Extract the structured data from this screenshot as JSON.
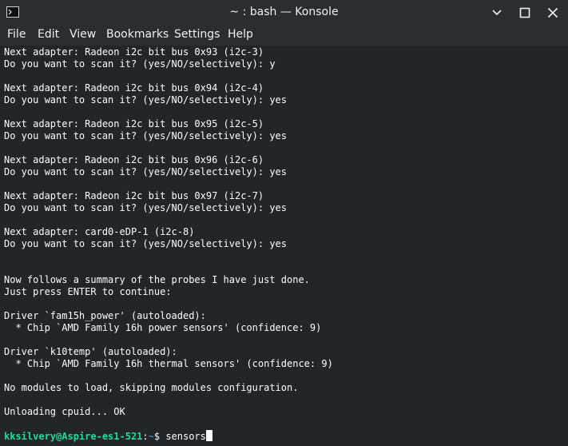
{
  "window": {
    "title": "~ : bash — Konsole",
    "icon": "terminal-app-icon",
    "controls": [
      "minimize-icon",
      "maximize-icon",
      "close-icon"
    ]
  },
  "menu": {
    "file": "File",
    "edit": "Edit",
    "view": "View",
    "bookmarks": "Bookmarks",
    "settings": "Settings",
    "help": "Help"
  },
  "terminal": {
    "output": "Next adapter: Radeon i2c bit bus 0x93 (i2c-3)\nDo you want to scan it? (yes/NO/selectively): y\n\nNext adapter: Radeon i2c bit bus 0x94 (i2c-4)\nDo you want to scan it? (yes/NO/selectively): yes\n\nNext adapter: Radeon i2c bit bus 0x95 (i2c-5)\nDo you want to scan it? (yes/NO/selectively): yes\n\nNext adapter: Radeon i2c bit bus 0x96 (i2c-6)\nDo you want to scan it? (yes/NO/selectively): yes\n\nNext adapter: Radeon i2c bit bus 0x97 (i2c-7)\nDo you want to scan it? (yes/NO/selectively): yes\n\nNext adapter: card0-eDP-1 (i2c-8)\nDo you want to scan it? (yes/NO/selectively): yes\n\n\nNow follows a summary of the probes I have just done.\nJust press ENTER to continue:\n\nDriver `fam15h_power' (autoloaded):\n  * Chip `AMD Family 16h power sensors' (confidence: 9)\n\nDriver `k10temp' (autoloaded):\n  * Chip `AMD Family 16h thermal sensors' (confidence: 9)\n\nNo modules to load, skipping modules configuration.\n\nUnloading cpuid... OK\n",
    "prompt_user": "kksilvery@Aspire-es1-521",
    "prompt_sep": ":",
    "prompt_path": "~",
    "prompt_symbol": "$ ",
    "command": "sensors"
  },
  "colors": {
    "background": "#232629",
    "titlebar": "#2a2e32",
    "text": "#fcfcfc",
    "prompt_user": "#1cdc9a",
    "prompt_path": "#3daee9"
  }
}
